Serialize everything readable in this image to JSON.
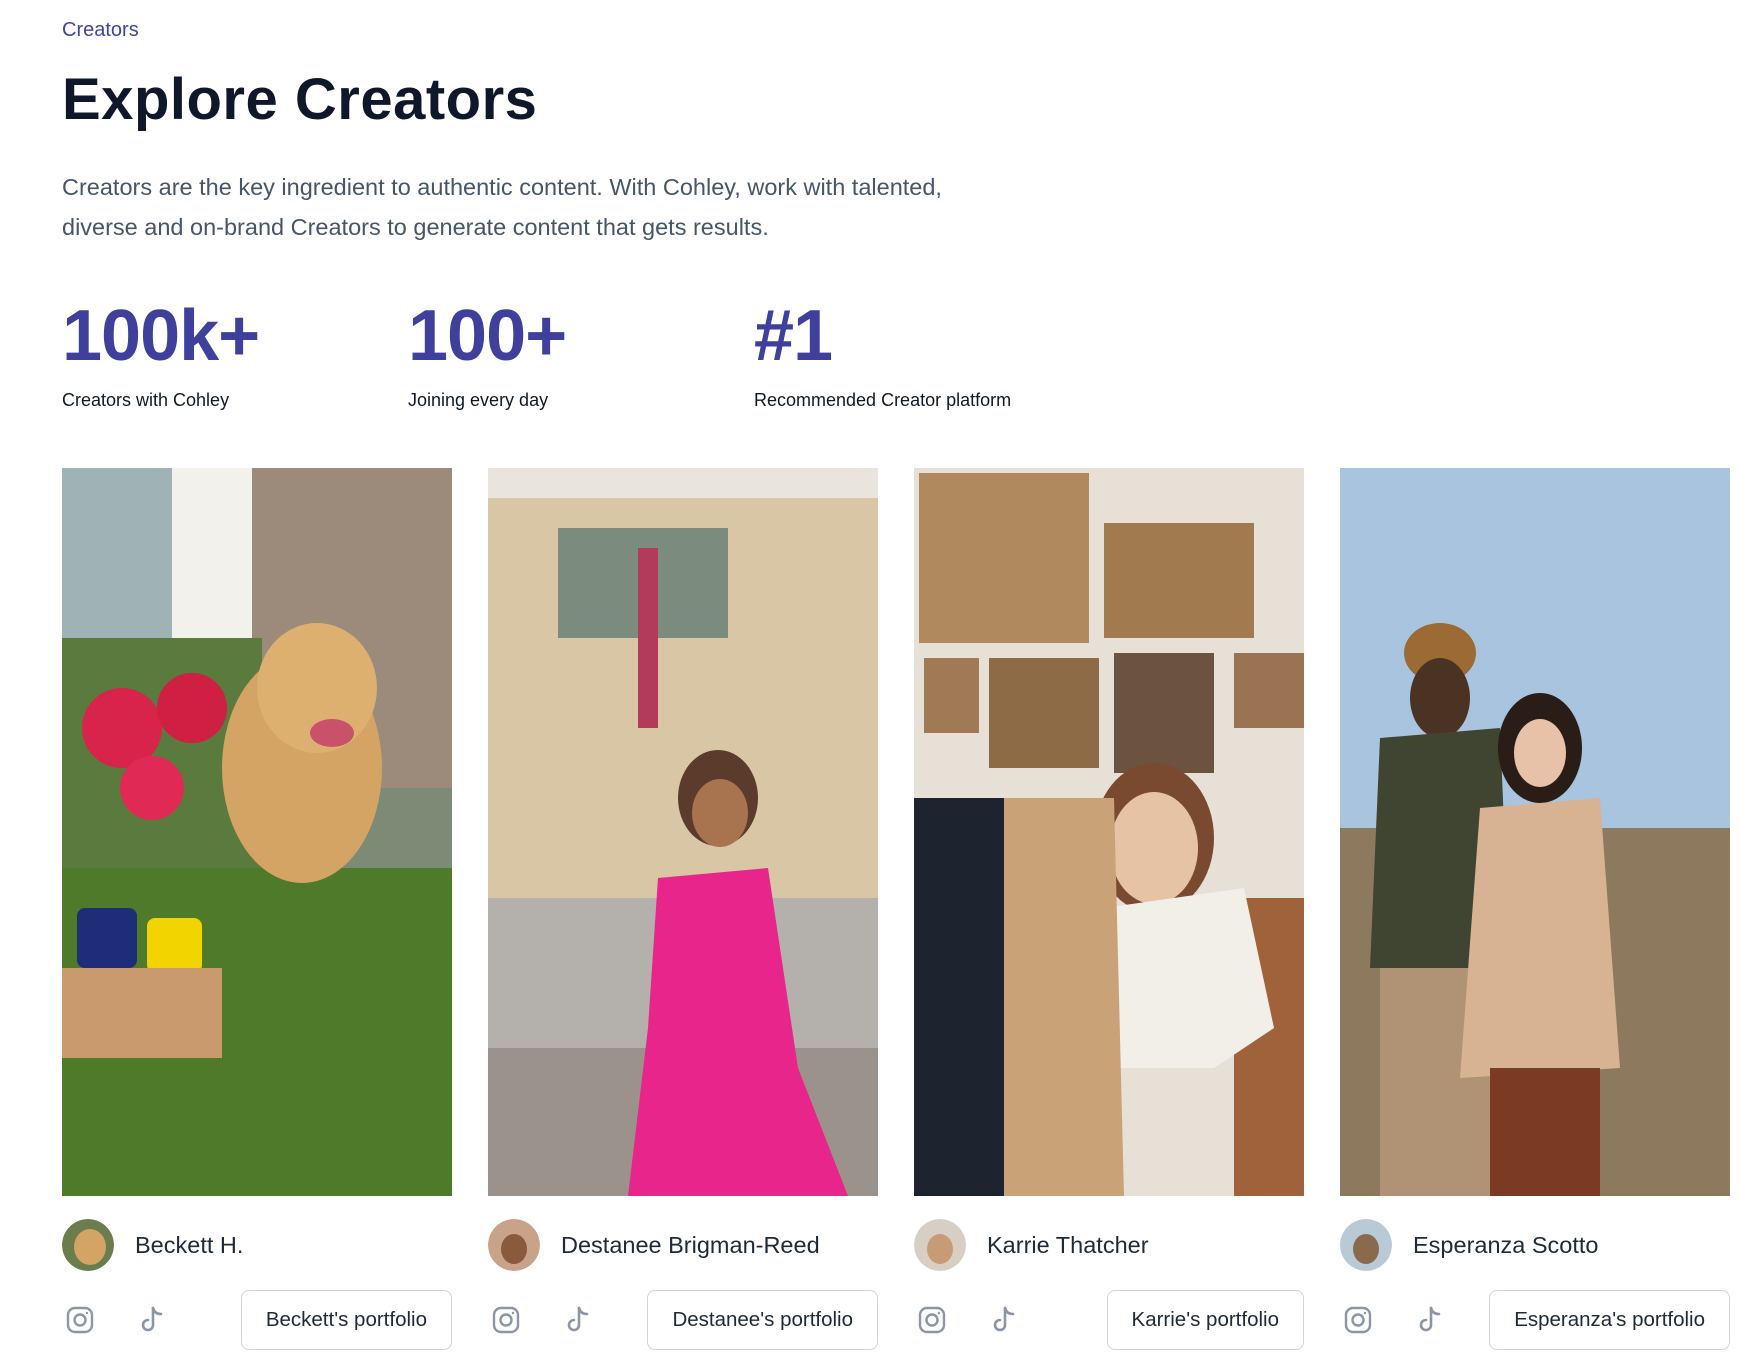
{
  "breadcrumb": "Creators",
  "page_title": "Explore Creators",
  "description_line1": "Creators are the key ingredient to authentic content. With Cohley, work with talented,",
  "description_line2": "diverse and on-brand Creators to generate content that gets results.",
  "stats": [
    {
      "value": "100k+",
      "label": "Creators with Cohley"
    },
    {
      "value": "100+",
      "label": "Joining every day"
    },
    {
      "value": "#1",
      "label": "Recommended Creator platform"
    }
  ],
  "creators": [
    {
      "name": "Beckett H.",
      "portfolio_label": "Beckett's portfolio",
      "photo_icon": "golden-retriever-photo"
    },
    {
      "name": "Destanee Brigman-Reed",
      "portfolio_label": "Destanee's portfolio",
      "photo_icon": "woman-pink-jumpsuit-photo"
    },
    {
      "name": "Karrie Thatcher",
      "portfolio_label": "Karrie's portfolio",
      "photo_icon": "woman-amazon-box-photo"
    },
    {
      "name": "Esperanza Scotto",
      "portfolio_label": "Esperanza's portfolio",
      "photo_icon": "couple-field-photo"
    }
  ],
  "social_icons": [
    "instagram-icon",
    "tiktok-icon"
  ],
  "colors": {
    "accent": "#3f3f9c",
    "breadcrumb": "#4043a3",
    "title": "#0f172a",
    "body_text": "#475569",
    "button_border": "#cfd4dc"
  }
}
